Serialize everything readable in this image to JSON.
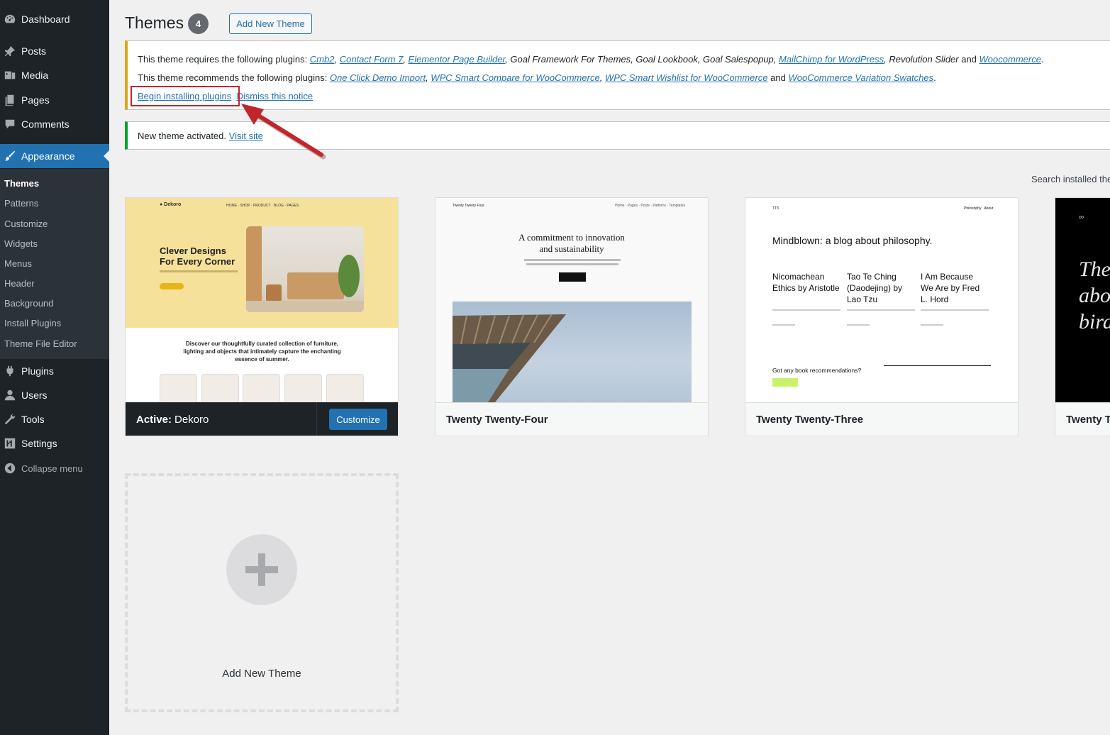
{
  "sidebar": {
    "menu": {
      "dashboard": "Dashboard",
      "posts": "Posts",
      "media": "Media",
      "pages": "Pages",
      "comments": "Comments",
      "appearance": "Appearance",
      "plugins": "Plugins",
      "users": "Users",
      "tools": "Tools",
      "settings": "Settings",
      "collapse": "Collapse menu"
    },
    "submenu": {
      "themes": "Themes",
      "patterns": "Patterns",
      "customize": "Customize",
      "widgets": "Widgets",
      "menus": "Menus",
      "header": "Header",
      "background": "Background",
      "install_plugins": "Install Plugins",
      "theme_file_editor": "Theme File Editor"
    }
  },
  "header": {
    "title": "Themes",
    "count": "4",
    "add_new": "Add New Theme"
  },
  "notice_plugins": {
    "requires_prefix": "This theme requires the following plugins: ",
    "required": {
      "cmb2": "Cmb2",
      "cf7": "Contact Form 7",
      "elementor": "Elementor Page Builder",
      "goal_text": "Goal Framework For Themes, Goal Lookbook, Goal Salespopup, ",
      "mailchimp": "MailChimp for WordPress",
      "rev_text": "Revolution Slider",
      "and": " and ",
      "woocommerce": "Woocommerce"
    },
    "recommends_prefix": "This theme recommends the following plugins: ",
    "recommended": {
      "ocdi": "One Click Demo Import",
      "compare": "WPC Smart Compare for WooCommerce",
      "wishlist": "WPC Smart Wishlist for WooCommerce",
      "and": "and",
      "swatches": "WooCommerce Variation Swatches"
    },
    "begin_install": "Begin installing plugins",
    "dismiss": "Dismiss this notice"
  },
  "notice_activated": {
    "text": "New theme activated.",
    "visit": "Visit site"
  },
  "search": {
    "label": "Search installed the"
  },
  "themes": {
    "active_label": "Active:",
    "active_name": "Dekoro",
    "customize": "Customize",
    "t2": "Twenty Twenty-Four",
    "t3": "Twenty Twenty-Three",
    "t4": "Twenty Tw"
  },
  "dekoro_preview": {
    "heading1": "Clever Designs",
    "heading2": "For Every Corner",
    "body1": "Discover our thoughtfully curated collection of furniture,",
    "body2": "lighting and objects that intimately capture the enchanting",
    "body3": "essence of summer."
  },
  "tt4_preview": {
    "brand": "Twenty Twenty Four",
    "heading1": "A commitment to innovation",
    "heading2": "and sustainability"
  },
  "tt3_preview": {
    "brand": "TT3",
    "nav": "Philosophy   About",
    "title": "Mindblown: a blog about philosophy.",
    "col1": "Nicomachean Ethics by Aristotle",
    "col2": "Tao Te Ching (Daodejing) by Lao Tzu",
    "col3": "I Am Because We Are by Fred L. Hord",
    "question": "Got any book recommendations?"
  },
  "tt2_preview": {
    "text": "The abo bird"
  },
  "add_theme_card": {
    "label": "Add New Theme"
  },
  "colors": {
    "sidebar_bg": "#1d2327",
    "accent": "#2271b1",
    "warning": "#dba617",
    "success": "#00a32a",
    "highlight": "#c0272d"
  }
}
